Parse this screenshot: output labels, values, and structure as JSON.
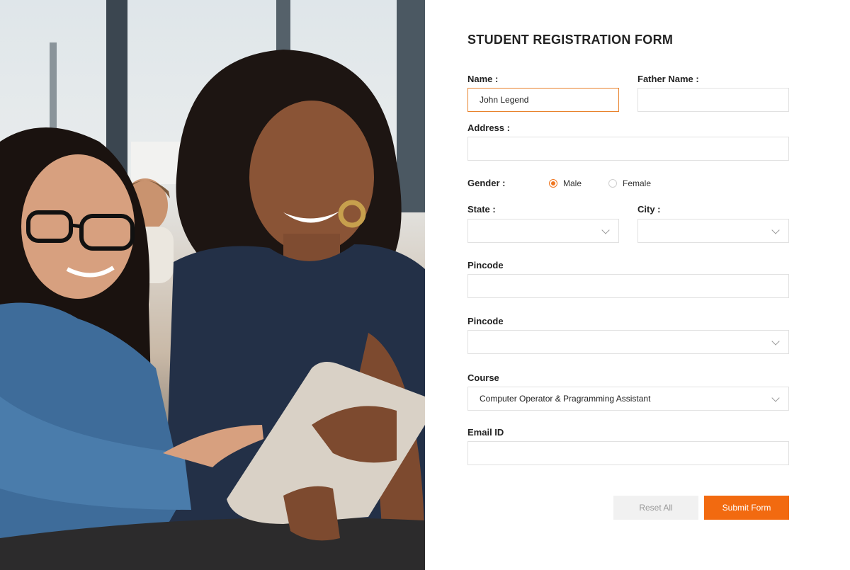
{
  "form": {
    "title": "STUDENT REGISTRATION FORM",
    "name": {
      "label": "Name :",
      "value": "John Legend"
    },
    "father_name": {
      "label": "Father Name :",
      "value": ""
    },
    "address": {
      "label": "Address :",
      "value": ""
    },
    "gender": {
      "label": "Gender :",
      "options": [
        {
          "label": "Male",
          "checked": true
        },
        {
          "label": "Female",
          "checked": false
        }
      ]
    },
    "state": {
      "label": "State :",
      "value": ""
    },
    "city": {
      "label": "City :",
      "value": ""
    },
    "pincode_input": {
      "label": "Pincode",
      "value": ""
    },
    "pincode_select": {
      "label": "Pincode",
      "value": ""
    },
    "course": {
      "label": "Course",
      "value": "Computer Operator & Pragramming Assistant"
    },
    "email": {
      "label": "Email ID",
      "value": ""
    },
    "buttons": {
      "reset": "Reset All",
      "submit": "Submit Form"
    }
  },
  "colors": {
    "accent": "#f26a10",
    "active_border": "#e8822c",
    "field_border": "#e1e1e1",
    "reset_bg": "#f1f1f1"
  },
  "icons": [
    "chevron-down-icon",
    "radio-checked-icon",
    "radio-unchecked-icon"
  ]
}
